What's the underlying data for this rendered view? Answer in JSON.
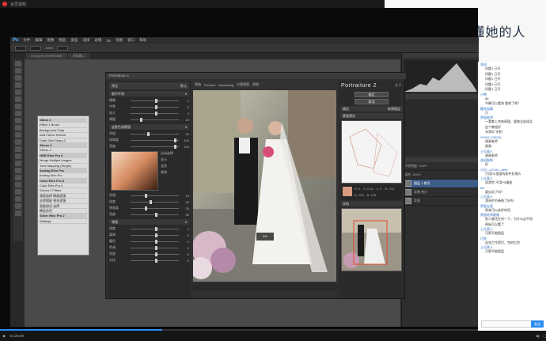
{
  "banner": {
    "text": "好东西给最懂她的人"
  },
  "player": {
    "title": "会员视频",
    "time": "01:20:09",
    "progress": 0.34
  },
  "ps": {
    "logo": "Ps",
    "menus": [
      "文件",
      "编辑",
      "图像",
      "图层",
      "类型",
      "选择",
      "滤镜",
      "3D",
      "视图",
      "窗口",
      "帮助"
    ],
    "opacity": "100%",
    "tabs": [
      "00.jpg @ 25%(RGB/8)",
      "未标题-1"
    ]
  },
  "presets": {
    "items": [
      {
        "label": "Nikon 2",
        "hd": true
      },
      {
        "label": "Effect 1      Brush",
        "hd": false
      },
      {
        "label": "Background    Gray",
        "hd": false
      },
      {
        "label": "Add Filters   Texture",
        "hd": false
      },
      {
        "label": "Fade Skin     Sharp 2",
        "hd": false
      },
      {
        "label": "Stress 2",
        "hd": true
      },
      {
        "label": "Stress 2",
        "hd": false
      },
      {
        "label": "HDR Efex Pro 2",
        "hd": true
      },
      {
        "label": "Merge Multiple Images",
        "hd": false
      },
      {
        "label": "Tone Mapping (Single)",
        "hd": false
      },
      {
        "label": "Analog Efex Pro",
        "hd": true
      },
      {
        "label": "Analog Efex Pro",
        "hd": false
      },
      {
        "label": "Color Efex Pro 4",
        "hd": true
      },
      {
        "label": "Color Efex Pro 4",
        "hd": false
      },
      {
        "label": "Viveza 2    Filters",
        "hd": false
      },
      {
        "label": "清除选择     降噪滤镜",
        "hd": false
      },
      {
        "label": "去除瑕疵     锐化滤镜",
        "hd": false
      },
      {
        "label": "智能锐化     选择",
        "hd": false
      },
      {
        "label": "降低杂色",
        "hd": false
      },
      {
        "label": "Silver Efex Pro 2",
        "hd": true
      },
      {
        "label": "Settings",
        "hd": false
      }
    ]
  },
  "portraiture": {
    "title": "Portraiture 2",
    "preset_label": "预设",
    "preset_value": "默认",
    "sections": {
      "detail": "细节平滑",
      "skin": "皮肤色调蒙版",
      "enhance": "增强"
    },
    "detail_sliders": [
      {
        "label": "精细",
        "value": "0",
        "pos": 0.5
      },
      {
        "label": "中等",
        "value": "0",
        "pos": 0.5
      },
      {
        "label": "较大",
        "value": "0",
        "pos": 0.5
      },
      {
        "label": "阈值",
        "value": "20",
        "pos": 0.2
      }
    ],
    "skin_sliders": [
      {
        "label": "色相",
        "value": "20",
        "pos": 0.35
      },
      {
        "label": "饱和度",
        "value": "100",
        "pos": 0.9
      },
      {
        "label": "亮度",
        "value": "100",
        "pos": 0.9
      }
    ],
    "skin_options": [
      "自动选择",
      "显示",
      "混合",
      "柔和"
    ],
    "skin_sliders2": [
      {
        "label": "色相",
        "value": "15",
        "pos": 0.3
      },
      {
        "label": "纬度",
        "value": "40",
        "pos": 0.4
      },
      {
        "label": "饱和度",
        "value": "25",
        "pos": 0.3
      },
      {
        "label": "亮度",
        "value": "50",
        "pos": 0.5
      }
    ],
    "enhance_sliders": [
      {
        "label": "锐度",
        "value": "0",
        "pos": 0.5
      },
      {
        "label": "柔和",
        "value": "0",
        "pos": 0.5
      },
      {
        "label": "暖色",
        "value": "0",
        "pos": 0.5
      },
      {
        "label": "色调",
        "value": "0",
        "pos": 0.5
      },
      {
        "label": "亮度",
        "value": "0",
        "pos": 0.5
      },
      {
        "label": "对比",
        "value": "0",
        "pos": 0.5
      }
    ],
    "toolbar": [
      "原始",
      "Preview",
      "Bracketing",
      "分割视图",
      "原图"
    ],
    "zoom": "9%",
    "ok_label": "确定",
    "cancel_label": "取消",
    "about_label": "关于",
    "help_label": "帮助",
    "output_label": "输出",
    "output_value": "新建图层",
    "mask_label": "蒙版预览",
    "mask_info": [
      "H: 0",
      "S: 0.00",
      "L: 0",
      "R: 214",
      "G: 154",
      "B: 126"
    ],
    "nav_label": "导航"
  },
  "layers": {
    "rows": [
      {
        "label": "图层 1 拷贝",
        "sel": true
      },
      {
        "label": "背景 拷贝",
        "sel": false
      },
      {
        "label": "背景",
        "sel": false
      }
    ],
    "opacity_label": "不透明度: 100%",
    "fill_label": "填充: 100%"
  },
  "chat": {
    "messages": [
      {
        "user": "花斑",
        "text": "问题1 已开"
      },
      {
        "user": "",
        "text": "问题1 已开"
      },
      {
        "user": "",
        "text": "问题1 已开"
      },
      {
        "user": "",
        "text": "问题1 已开"
      },
      {
        "user": "",
        "text": "问题1 已开"
      },
      {
        "user": "小鸭",
        "text": "88"
      },
      {
        "user": "",
        "text": "今晚可以看到 看吧了吧？"
      },
      {
        "user": "樱花轻舞",
        "text": "😊"
      },
      {
        "user": "界面老师",
        "text": "一套教上完来原理，要做全部成品"
      },
      {
        "user": "",
        "text": "这个教程好"
      },
      {
        "user": "",
        "text": "非常好 学到！"
      },
      {
        "user": "XONG.VISION",
        "text": "谢谢老师"
      },
      {
        "user": "",
        "text": "谢谢"
      },
      {
        "user": "上位表人",
        "text": "谢谢老师"
      },
      {
        "user": "虎斑狗狗",
        "text": "好"
      },
      {
        "user": "小贝—LEON—Mee",
        "text": "只用PS里面的软件处理么"
      },
      {
        "user": "上位表人",
        "text": "润滑完 不用PS磨皮"
      },
      {
        "user": "ttst",
        "text": "要自动了吗？"
      },
      {
        "user": "上位表人",
        "text": "漂亮的节奏做了好吗"
      },
      {
        "user": "界面在面",
        "text": "原来可以这样的用"
      },
      {
        "user": "界面老师客服",
        "text": "别人都还在听一下，为什么这不用"
      },
      {
        "user": "",
        "text": "原始可以看了"
      },
      {
        "user": "上位表人",
        "text": "可第不能图层"
      },
      {
        "user": "巧茶",
        "text": "这张工作是们，完的后完"
      },
      {
        "user": "上位表人",
        "text": "可第不能图层"
      }
    ],
    "send_label": "发送"
  }
}
